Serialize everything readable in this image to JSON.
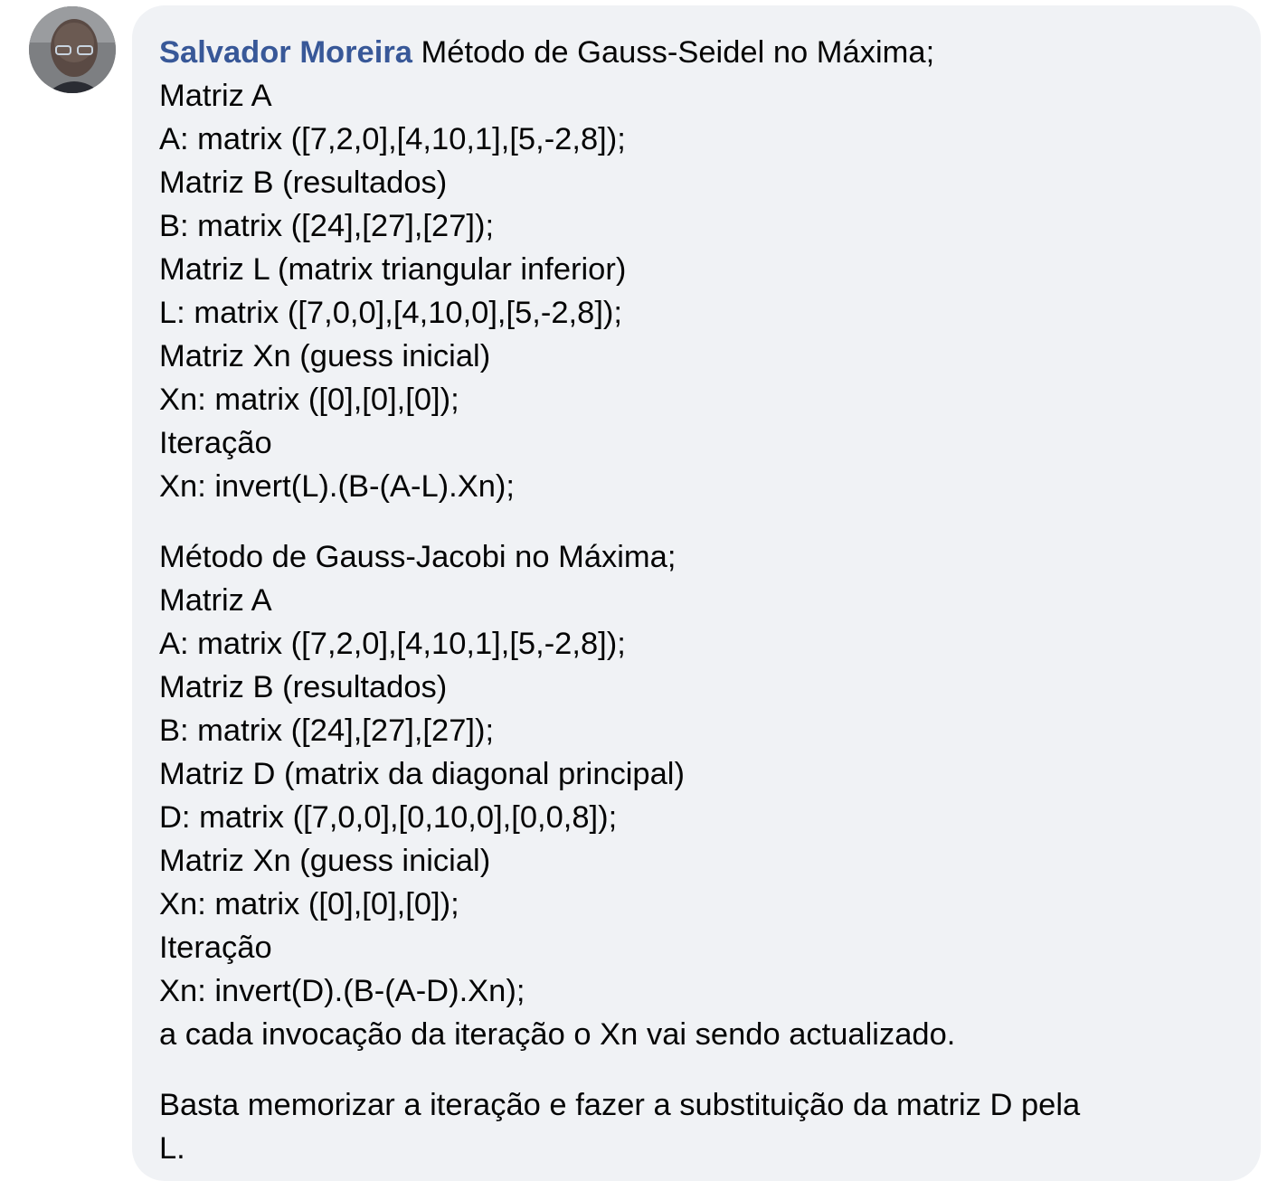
{
  "comment": {
    "author": "Salvador Moreira",
    "first_line": "Método de Gauss-Seidel no Máxima;",
    "section1_lines": [
      "Matriz A",
      "A: matrix ([7,2,0],[4,10,1],[5,-2,8]);",
      "Matriz B (resultados)",
      "B: matrix ([24],[27],[27]);",
      "Matriz L (matrix triangular inferior)",
      "L: matrix ([7,0,0],[4,10,0],[5,-2,8]);",
      "Matriz Xn (guess inicial)",
      "Xn: matrix ([0],[0],[0]);",
      "Iteração",
      "Xn: invert(L).(B-(A-L).Xn);"
    ],
    "section2_lines": [
      "Método de Gauss-Jacobi no Máxima;",
      "Matriz A",
      "A: matrix ([7,2,0],[4,10,1],[5,-2,8]);",
      "Matriz B (resultados)",
      "B: matrix ([24],[27],[27]);",
      "Matriz D (matrix da diagonal principal)",
      "D: matrix ([7,0,0],[0,10,0],[0,0,8]);",
      "Matriz Xn (guess inicial)",
      "Xn: matrix ([0],[0],[0]);",
      "Iteração",
      "Xn: invert(D).(B-(A-D).Xn);",
      "a cada invocação da iteração o Xn vai sendo actualizado."
    ],
    "section3_lines": [
      "Basta memorizar a iteração e fazer a substituição da matriz D pela",
      "L."
    ]
  },
  "colors": {
    "author": "#385898",
    "text": "#050505",
    "bubble_bg": "#f0f2f5"
  }
}
